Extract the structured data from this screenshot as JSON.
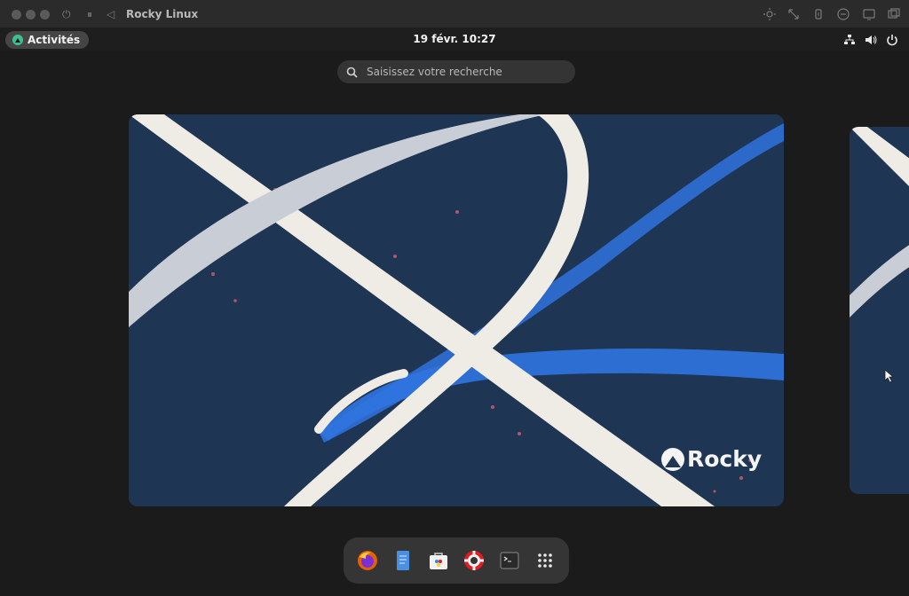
{
  "vm_window": {
    "title": "Rocky Linux",
    "left_icons": [
      "power-icon",
      "pause-icon",
      "back-icon"
    ],
    "right_icons": [
      "brightness-icon",
      "resize-icon",
      "usb-icon",
      "record-icon",
      "display-icon",
      "window-icon"
    ]
  },
  "topbar": {
    "activities_label": "Activités",
    "clock": "19 févr.  10:27",
    "icons": [
      "network-icon",
      "volume-icon",
      "power-icon"
    ]
  },
  "search": {
    "placeholder": "Saisissez votre recherche"
  },
  "wallpaper": {
    "brand_text": "Rocky"
  },
  "dock": {
    "apps": [
      "firefox-icon",
      "text-editor-icon",
      "software-icon",
      "help-icon",
      "terminal-icon",
      "app-grid-icon"
    ]
  },
  "colors": {
    "wallpaper_bg": "#1f3554",
    "ribbon": "#efece6",
    "accent_blue": "#2e6fd6",
    "rocky_green": "#3fbf8f"
  }
}
